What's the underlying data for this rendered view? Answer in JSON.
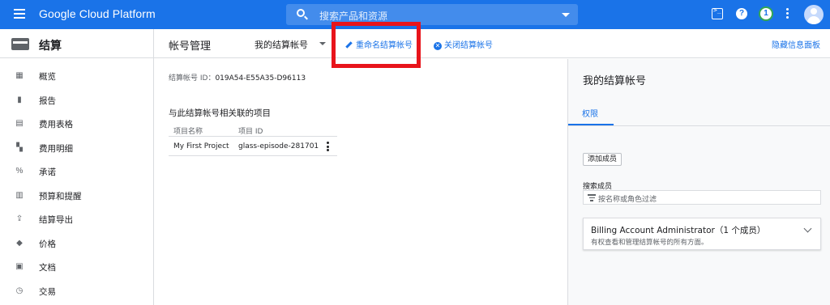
{
  "topbar": {
    "brand": "Google Cloud Platform",
    "search_placeholder": "搜索产品和资源",
    "notifications_count": "1",
    "color": "#1a73e8"
  },
  "sidebar": {
    "title": "结算",
    "items": [
      {
        "label": "概览",
        "icon": "dashboard-icon"
      },
      {
        "label": "报告",
        "icon": "bar-chart-icon"
      },
      {
        "label": "费用表格",
        "icon": "table-icon"
      },
      {
        "label": "费用明细",
        "icon": "breakdown-icon"
      },
      {
        "label": "承诺",
        "icon": "percent-icon"
      },
      {
        "label": "预算和提醒",
        "icon": "budget-icon"
      },
      {
        "label": "结算导出",
        "icon": "upload-icon"
      },
      {
        "label": "价格",
        "icon": "tag-icon"
      },
      {
        "label": "文档",
        "icon": "document-icon"
      },
      {
        "label": "交易",
        "icon": "clock-icon"
      }
    ]
  },
  "actionbar": {
    "title": "帐号管理",
    "account_select": "我的结算帐号",
    "rename_label": "重命名结算帐号",
    "close_label": "关闭结算帐号",
    "hide_panel_label": "隐藏信息面板"
  },
  "main": {
    "account_id_label": "结算帐号 ID：",
    "account_id_value": "019A54-E55A35-D96113",
    "projects_title": "与此结算帐号相关联的项目",
    "table": {
      "headers": [
        "项目名称",
        "项目 ID"
      ],
      "rows": [
        [
          "My First Project",
          "glass-episode-281701"
        ]
      ]
    }
  },
  "panel": {
    "title": "我的结算帐号",
    "tab": "权限",
    "add_member": "添加成员",
    "search_label": "搜索成员",
    "filter_placeholder": "按名称或角色过滤",
    "role_name": "Billing Account Administrator（1 个成员）",
    "role_desc": "有权查看和管理结算帐号的所有方面。"
  }
}
